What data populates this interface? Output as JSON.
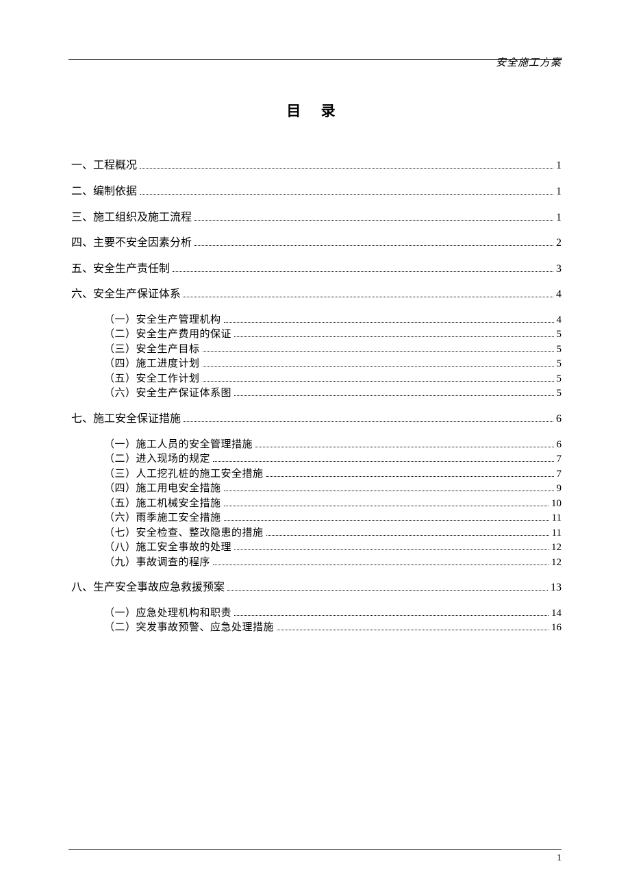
{
  "header": {
    "title": "安全施工方案"
  },
  "title": "目  录",
  "toc": [
    {
      "level": 1,
      "label": "一、工程概况",
      "page": "1"
    },
    {
      "level": 1,
      "label": "二、编制依据",
      "page": "1"
    },
    {
      "level": 1,
      "label": "三、施工组织及施工流程",
      "page": "1"
    },
    {
      "level": 1,
      "label": "四、主要不安全因素分析",
      "page": "2"
    },
    {
      "level": 1,
      "label": "五、安全生产责任制",
      "page": "3"
    },
    {
      "level": 1,
      "label": "六、安全生产保证体系",
      "page": "4",
      "children": [
        {
          "label": "（一）安全生产管理机构",
          "page": "4"
        },
        {
          "label": "（二）安全生产费用的保证",
          "page": "5"
        },
        {
          "label": "（三）安全生产目标",
          "page": "5"
        },
        {
          "label": "（四）施工进度计划",
          "page": "5"
        },
        {
          "label": "（五）安全工作计划",
          "page": "5"
        },
        {
          "label": "（六）安全生产保证体系图",
          "page": "5"
        }
      ]
    },
    {
      "level": 1,
      "label": "七、施工安全保证措施",
      "page": "6",
      "children": [
        {
          "label": "（一）施工人员的安全管理措施",
          "page": "6"
        },
        {
          "label": "（二）进入现场的规定",
          "page": "7"
        },
        {
          "label": "（三）人工挖孔桩的施工安全措施",
          "page": "7"
        },
        {
          "label": "（四）施工用电安全措施",
          "page": "9"
        },
        {
          "label": "（五）施工机械安全措施",
          "page": "10"
        },
        {
          "label": "（六）雨季施工安全措施",
          "page": "11"
        },
        {
          "label": "（七）安全检查、整改隐患的措施",
          "page": "11"
        },
        {
          "label": "（八）施工安全事故的处理",
          "page": "12"
        },
        {
          "label": "（九）事故调查的程序",
          "page": "12"
        }
      ]
    },
    {
      "level": 1,
      "label": "八、生产安全事故应急救援预案",
      "page": "13",
      "children": [
        {
          "label": "（一）应急处理机构和职责",
          "page": "14"
        },
        {
          "label": "（二）突发事故预警、应急处理措施",
          "page": "16"
        }
      ]
    }
  ],
  "footer": {
    "page_number": "1"
  }
}
